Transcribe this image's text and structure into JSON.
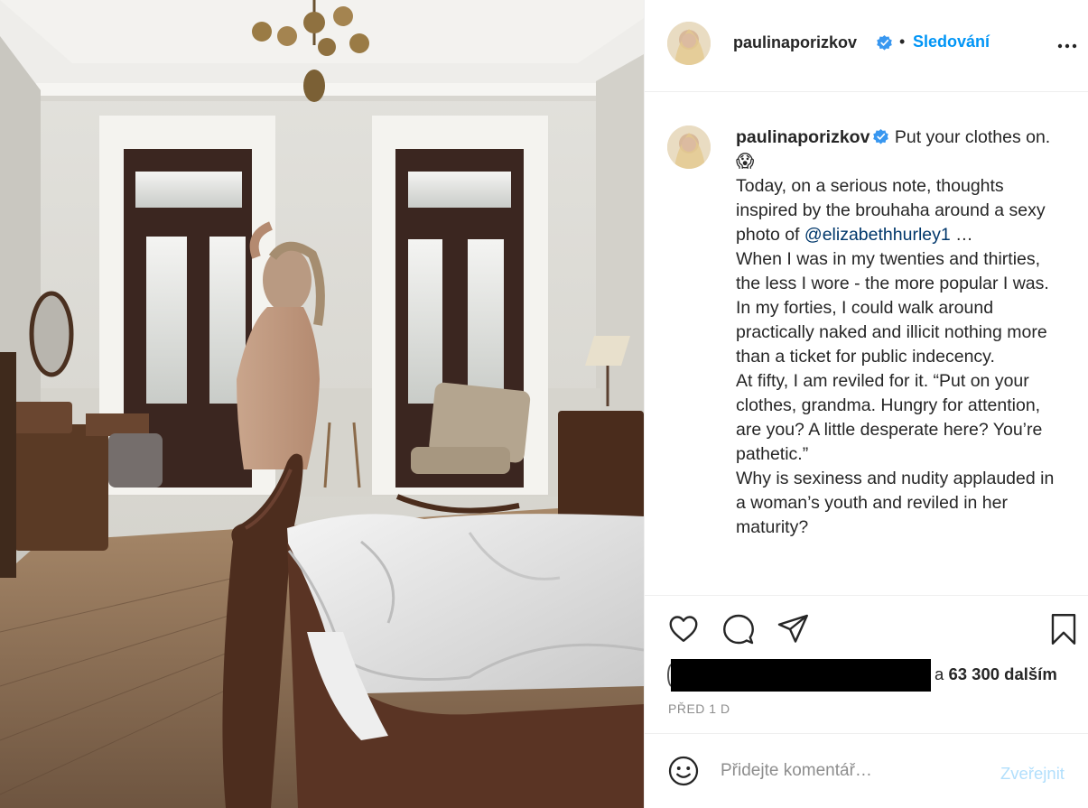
{
  "post": {
    "username": "paulinaporizkov",
    "follow_label": "Sledování",
    "separator": "•"
  },
  "caption": {
    "username": "paulinaporizkov",
    "title_line": "Put your clothes on. 😱",
    "intro_before_mention": "Today, on a serious note, thoughts inspired by the brouhaha around a sexy photo of",
    "mention": "@elizabethhurley1",
    "intro_after_mention": "…",
    "para1": "When I was in my twenties and thirties, the less I wore - the more popular I was.",
    "para2": "In my forties, I could walk around practically naked and illicit nothing more than a ticket for public indecency.",
    "para3": "At fifty, I am reviled for it. “Put on your clothes, grandma. Hungry for attention, are you? A little desperate here? You’re pathetic.”",
    "para4": "Why is sexiness and nudity applauded in a woman’s youth and reviled in her maturity?"
  },
  "likes": {
    "connector": "a",
    "count_text": "63 300 dalším"
  },
  "timestamp": "PŘED 1 D",
  "comment": {
    "placeholder": "Přidejte komentář…",
    "publish_label": "Zveřejnit"
  },
  "icons": {
    "like": "heart-icon",
    "comment": "comment-bubble-icon",
    "share": "paper-plane-icon",
    "save": "bookmark-icon",
    "more": "more-horizontal-icon",
    "emoji": "smiley-icon",
    "verified": "verified-badge-icon"
  },
  "colors": {
    "link_blue": "#0095f6",
    "verified_blue": "#3897f0",
    "publish_disabled": "#b2dffc",
    "muted": "#8e8e8e"
  }
}
